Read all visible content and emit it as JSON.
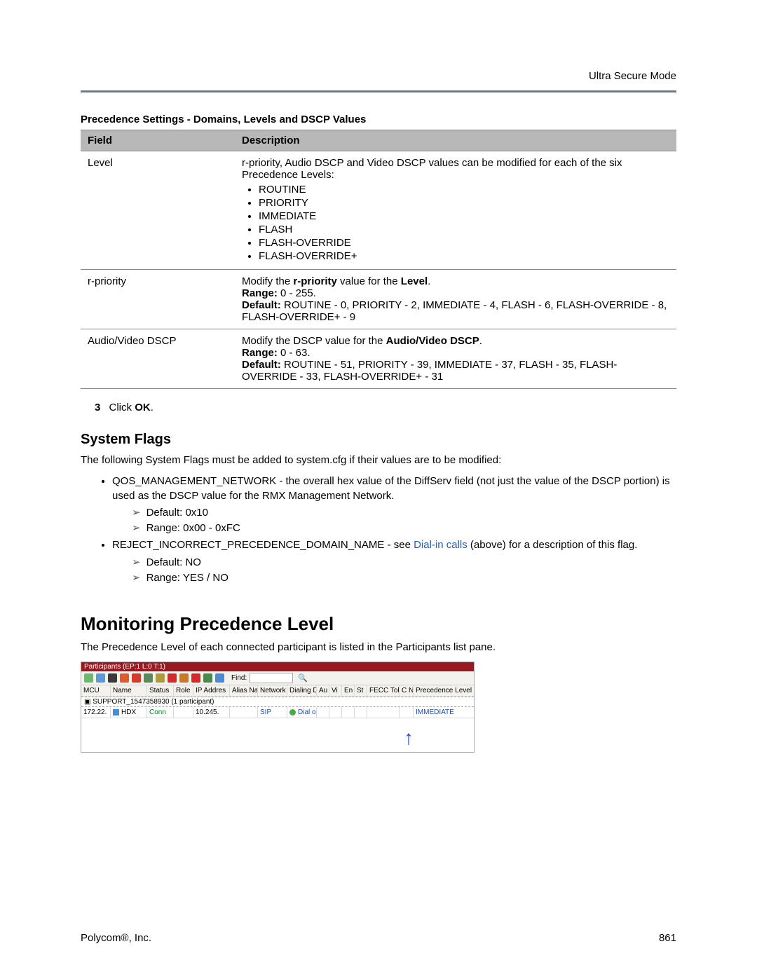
{
  "header": {
    "right": "Ultra Secure Mode"
  },
  "table": {
    "caption": "Precedence Settings - Domains, Levels and DSCP Values",
    "head": {
      "field": "Field",
      "desc": "Description"
    },
    "rows": {
      "level": {
        "field": "Level",
        "intro": "r-priority, Audio DSCP and Video DSCP values can be modified for each of the six Precedence Levels:",
        "items": [
          "ROUTINE",
          "PRIORITY",
          "IMMEDIATE",
          "FLASH",
          "FLASH-OVERRIDE",
          "FLASH-OVERRIDE+"
        ]
      },
      "rpriority": {
        "field": "r-priority",
        "line1a": "Modify the ",
        "line1b": "r-priority",
        "line1c": " value for the ",
        "line1d": "Level",
        "line1e": ".",
        "range_label": "Range:",
        "range_val": " 0 - 255.",
        "default_label": "Default:",
        "default_val": " ROUTINE - 0, PRIORITY - 2, IMMEDIATE - 4, FLASH - 6, FLASH-OVERRIDE - 8, FLASH-OVERRIDE+ - 9"
      },
      "avdscp": {
        "field": "Audio/Video DSCP",
        "line1a": "Modify the DSCP value for the ",
        "line1b": "Audio/Video DSCP",
        "line1c": ".",
        "range_label": "Range:",
        "range_val": " 0 - 63.",
        "default_label": "Default:",
        "default_val": " ROUTINE - 51, PRIORITY - 39, IMMEDIATE - 37, FLASH - 35, FLASH-OVERRIDE - 33, FLASH-OVERRIDE+ - 31"
      }
    }
  },
  "step": {
    "num": "3",
    "text_a": "Click ",
    "text_b": "OK",
    "text_c": "."
  },
  "flags": {
    "heading": "System Flags",
    "intro": "The following System Flags must be added to system.cfg if their values are to be modified:",
    "item1": "QOS_MANAGEMENT_NETWORK - the overall hex value of the DiffServ field (not just the value of the DSCP portion) is used as the DSCP value for the RMX Management Network.",
    "item1_default": "Default: 0x10",
    "item1_range": "Range: 0x00 - 0xFC",
    "item2_a": "REJECT_INCORRECT_PRECEDENCE_DOMAIN_NAME - see ",
    "item2_link": "Dial-in calls",
    "item2_b": " (above) for a description of this flag.",
    "item2_default": "Default: NO",
    "item2_range": "Range: YES / NO"
  },
  "monitor": {
    "heading": "Monitoring Precedence Level",
    "intro": "The Precedence Level of each connected participant is listed in the Participants list pane."
  },
  "pane": {
    "title": "Participants (EP:1 L:0 T:1)",
    "find_label": "Find:",
    "cols": {
      "mcu": "MCU",
      "name": "Name",
      "status": "Status",
      "role": "Role",
      "ip": "IP Addres",
      "alias": "Alias Na",
      "net": "Network",
      "dial": "Dialing Di",
      "au": "Au",
      "vi": "Vi",
      "en": "En",
      "fe": "St",
      "fecc": "FECC Tok",
      "cn": "C N",
      "prec": "Precedence Level"
    },
    "group": "SUPPORT_1547358930 (1 participant)",
    "row": {
      "mcu": "172.22.",
      "name": "HDX",
      "status": "Conn",
      "role": "",
      "ip": "10.245.",
      "alias": "",
      "net": "SIP",
      "dial": "Dial o",
      "prec": "IMMEDIATE"
    }
  },
  "footer": {
    "left": "Polycom®, Inc.",
    "right": "861"
  }
}
